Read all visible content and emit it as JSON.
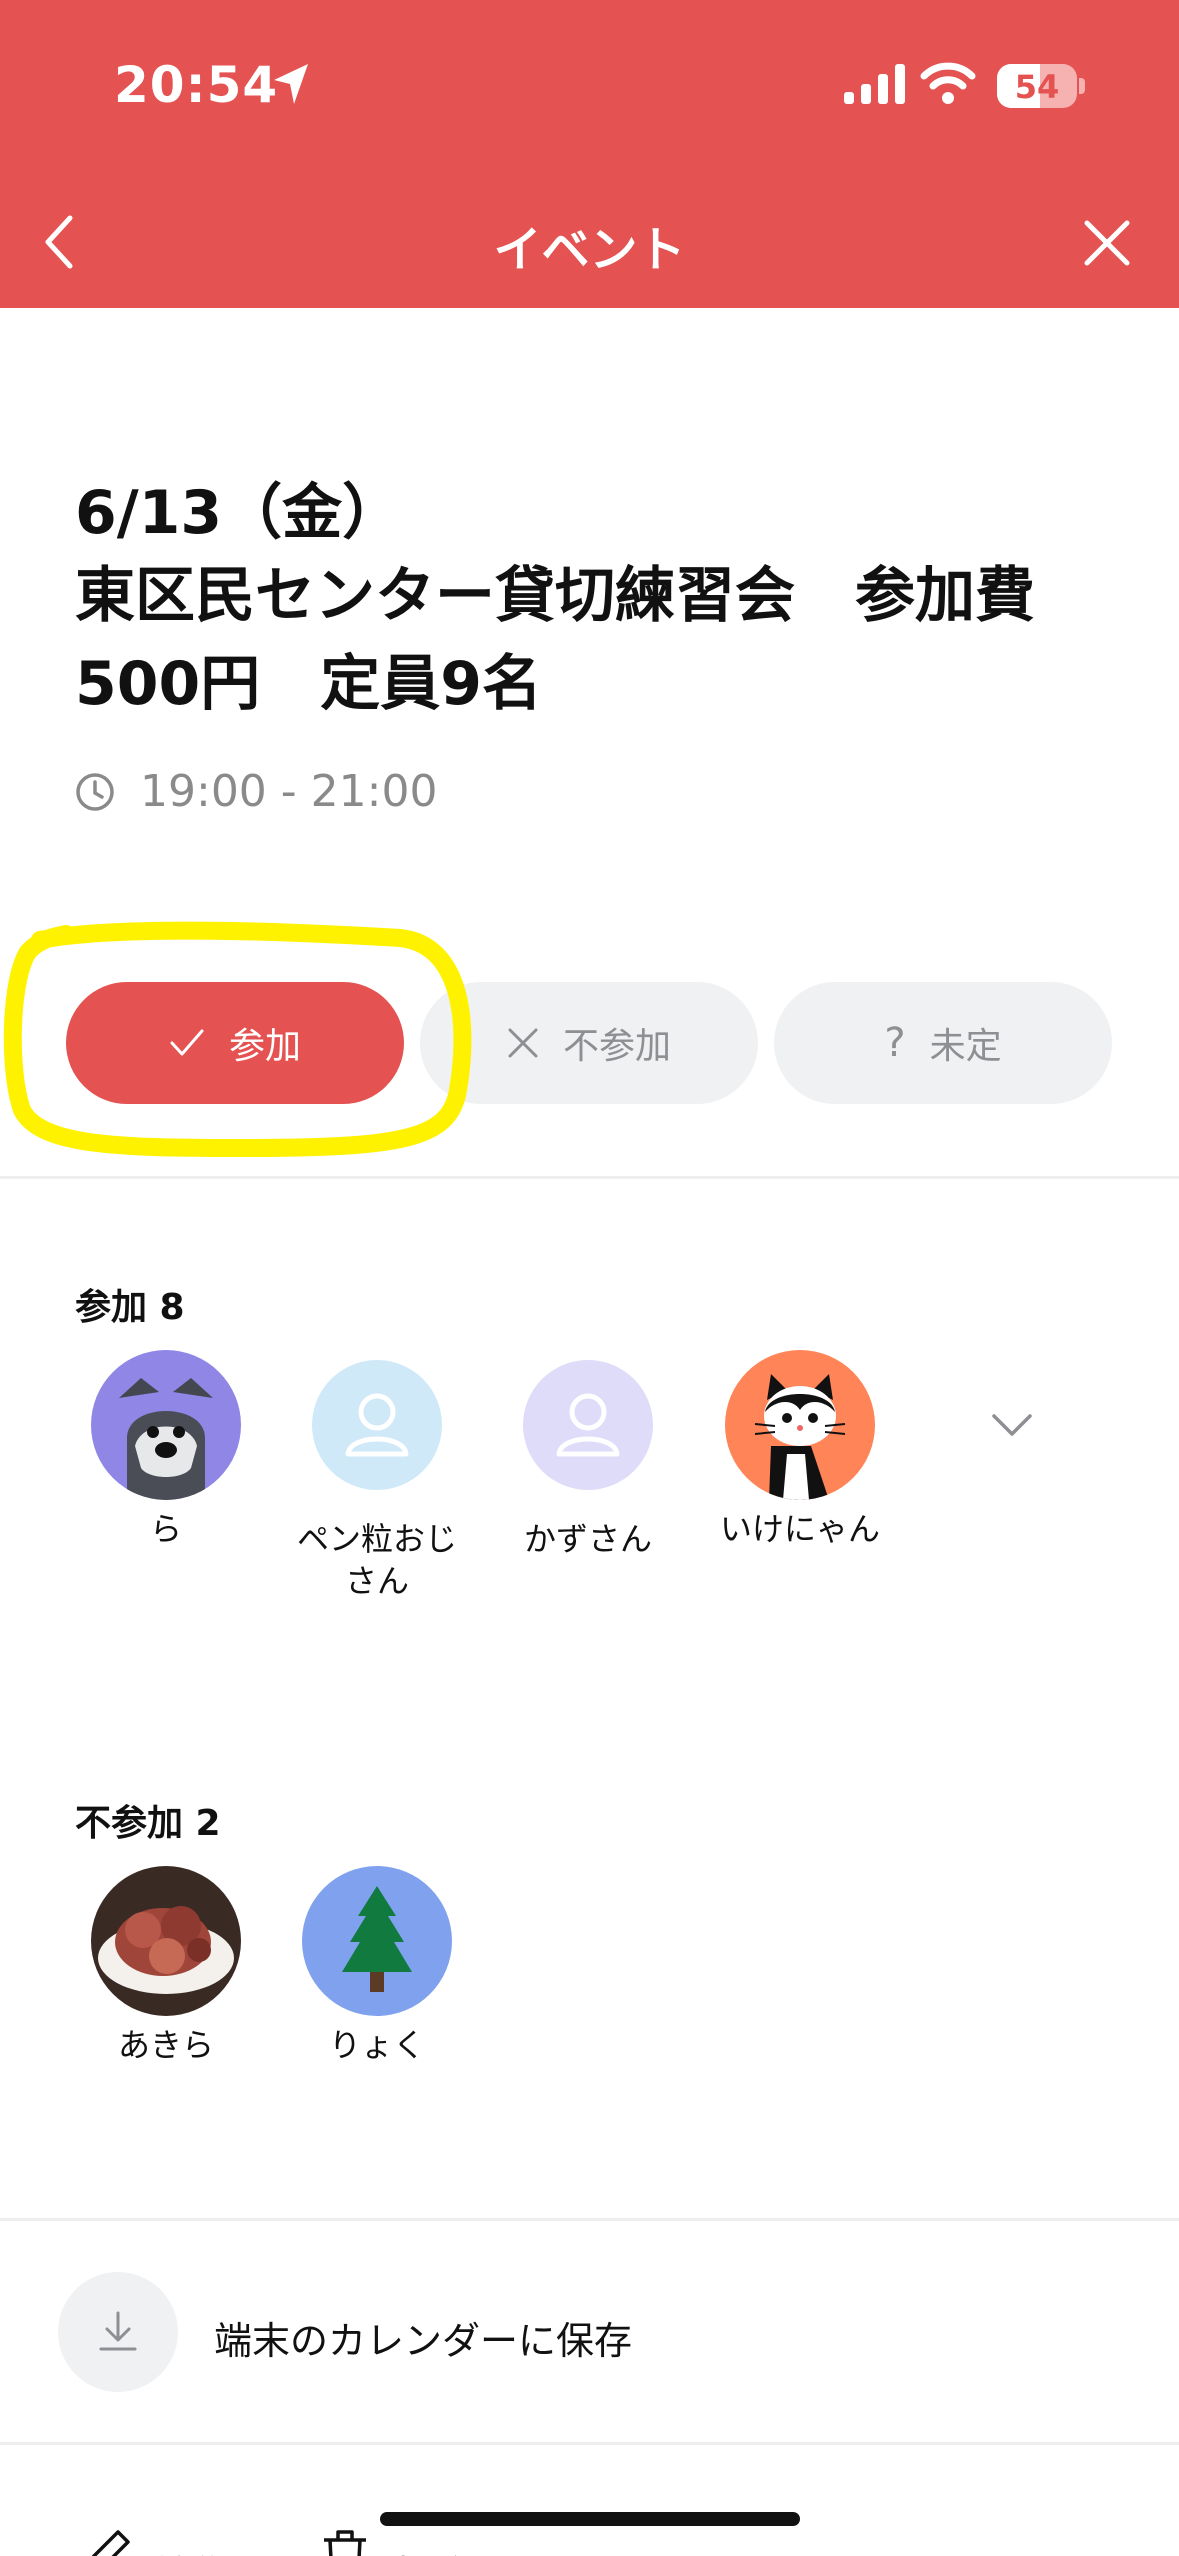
{
  "status_bar": {
    "time": "20:54",
    "battery_level": "54",
    "battery_fraction": 0.54
  },
  "nav": {
    "title": "イベント"
  },
  "event": {
    "date": "6/13（金）",
    "title": "東区民センター貸切練習会　参加費500円　定員9名",
    "time_range": "19:00 - 21:00"
  },
  "rsvp": {
    "join_label": "参加",
    "decline_label": "不参加",
    "undecided_label": "未定"
  },
  "attending": {
    "label": "参加 8",
    "members": [
      {
        "name": "ら",
        "avatar": "schnauzer-dog"
      },
      {
        "name": "ペン粒おじさん",
        "avatar": "default-person"
      },
      {
        "name": "かずさん",
        "avatar": "default-person"
      },
      {
        "name": "いけにゃん",
        "avatar": "cat"
      }
    ]
  },
  "declined": {
    "label": "不参加 2",
    "members": [
      {
        "name": "あきら",
        "avatar": "food-photo"
      },
      {
        "name": "りょく",
        "avatar": "pine-tree"
      }
    ]
  },
  "calendar": {
    "save_label": "端末のカレンダーに保存"
  },
  "actions": {
    "edit_label": "編集",
    "delete_label": "削除"
  },
  "colors": {
    "accent": "#e45251",
    "button_gray": "#f0f1f3",
    "highlight": "#fff200"
  },
  "icons": [
    "location-arrow-icon",
    "signal-icon",
    "wifi-icon",
    "battery-icon",
    "back-chevron-icon",
    "close-icon",
    "clock-icon",
    "check-icon",
    "x-icon",
    "question-icon",
    "chevron-down-icon",
    "download-icon",
    "pencil-icon",
    "trash-icon"
  ]
}
